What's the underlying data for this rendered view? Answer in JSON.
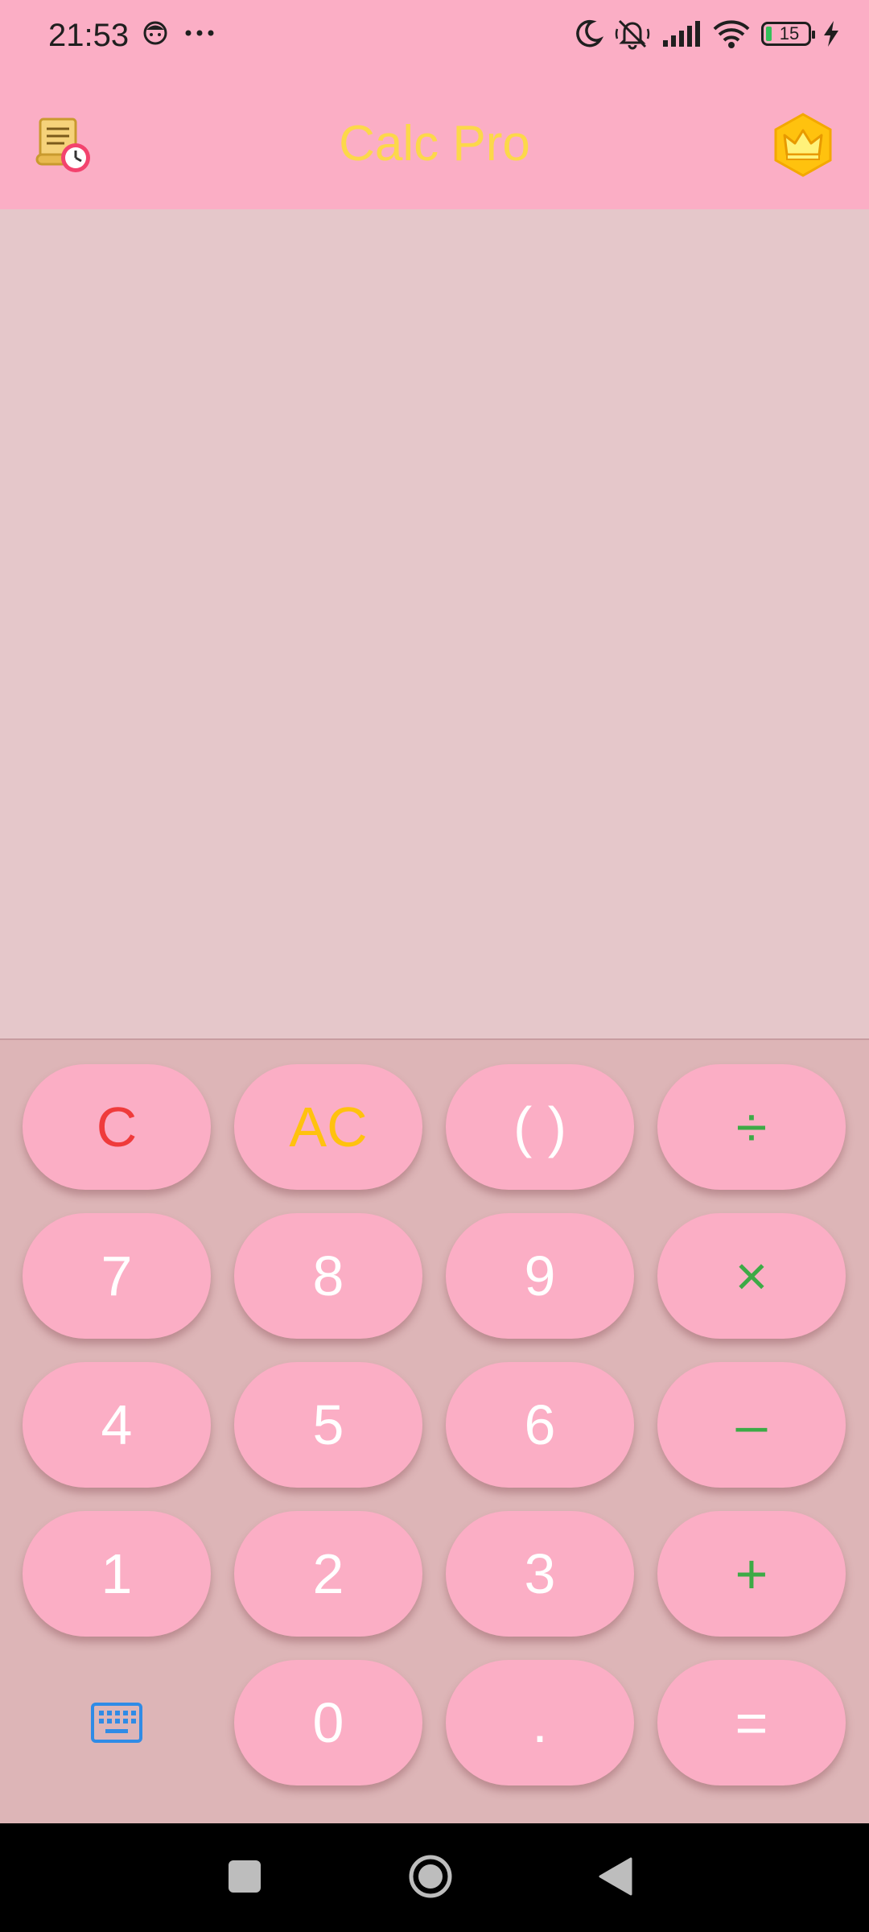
{
  "status_bar": {
    "time": "21:53",
    "battery_level": "15",
    "icons": [
      "face-notification-icon",
      "more-dots-icon",
      "do-not-disturb-moon-icon",
      "muted-bell-icon",
      "signal-icon",
      "wifi-icon",
      "battery-icon",
      "charging-icon"
    ]
  },
  "app_bar": {
    "title": "Calc Pro",
    "title_color": "#FCD84A",
    "left_icon": "history-scroll-clock-icon",
    "right_icon": "premium-crown-icon"
  },
  "display": {
    "expression": "",
    "result": ""
  },
  "keypad": {
    "keys": [
      {
        "label": "C",
        "color": "#EF3B3B"
      },
      {
        "label": "AC",
        "color": "#FFC20E"
      },
      {
        "label": "( )",
        "color": "#FFFFFF"
      },
      {
        "label": "÷",
        "color": "#3DAA46"
      },
      {
        "label": "7",
        "color": "#FFFFFF"
      },
      {
        "label": "8",
        "color": "#FFFFFF"
      },
      {
        "label": "9",
        "color": "#FFFFFF"
      },
      {
        "label": "×",
        "color": "#3DAA46"
      },
      {
        "label": "4",
        "color": "#FFFFFF"
      },
      {
        "label": "5",
        "color": "#FFFFFF"
      },
      {
        "label": "6",
        "color": "#FFFFFF"
      },
      {
        "label": "–",
        "color": "#3DAA46"
      },
      {
        "label": "1",
        "color": "#FFFFFF"
      },
      {
        "label": "2",
        "color": "#FFFFFF"
      },
      {
        "label": "3",
        "color": "#FFFFFF"
      },
      {
        "label": "+",
        "color": "#3DAA46"
      },
      {
        "label": "0",
        "color": "#FFFFFF"
      },
      {
        "label": ".",
        "color": "#FFFFFF"
      },
      {
        "label": "=",
        "color": "#FFFFFF"
      }
    ],
    "keyboard_icon": "keyboard-icon"
  },
  "colors": {
    "header_bg": "#FBAEC5",
    "display_bg": "#E5C7CA",
    "keypad_bg": "#DDB5B7",
    "key_bg": "#FBAEC5",
    "accent_green": "#3DAA46",
    "keyboard_icon_blue": "#2F8BE6"
  },
  "nav_bar": {
    "buttons": [
      "recents-icon",
      "home-icon",
      "back-icon"
    ]
  }
}
